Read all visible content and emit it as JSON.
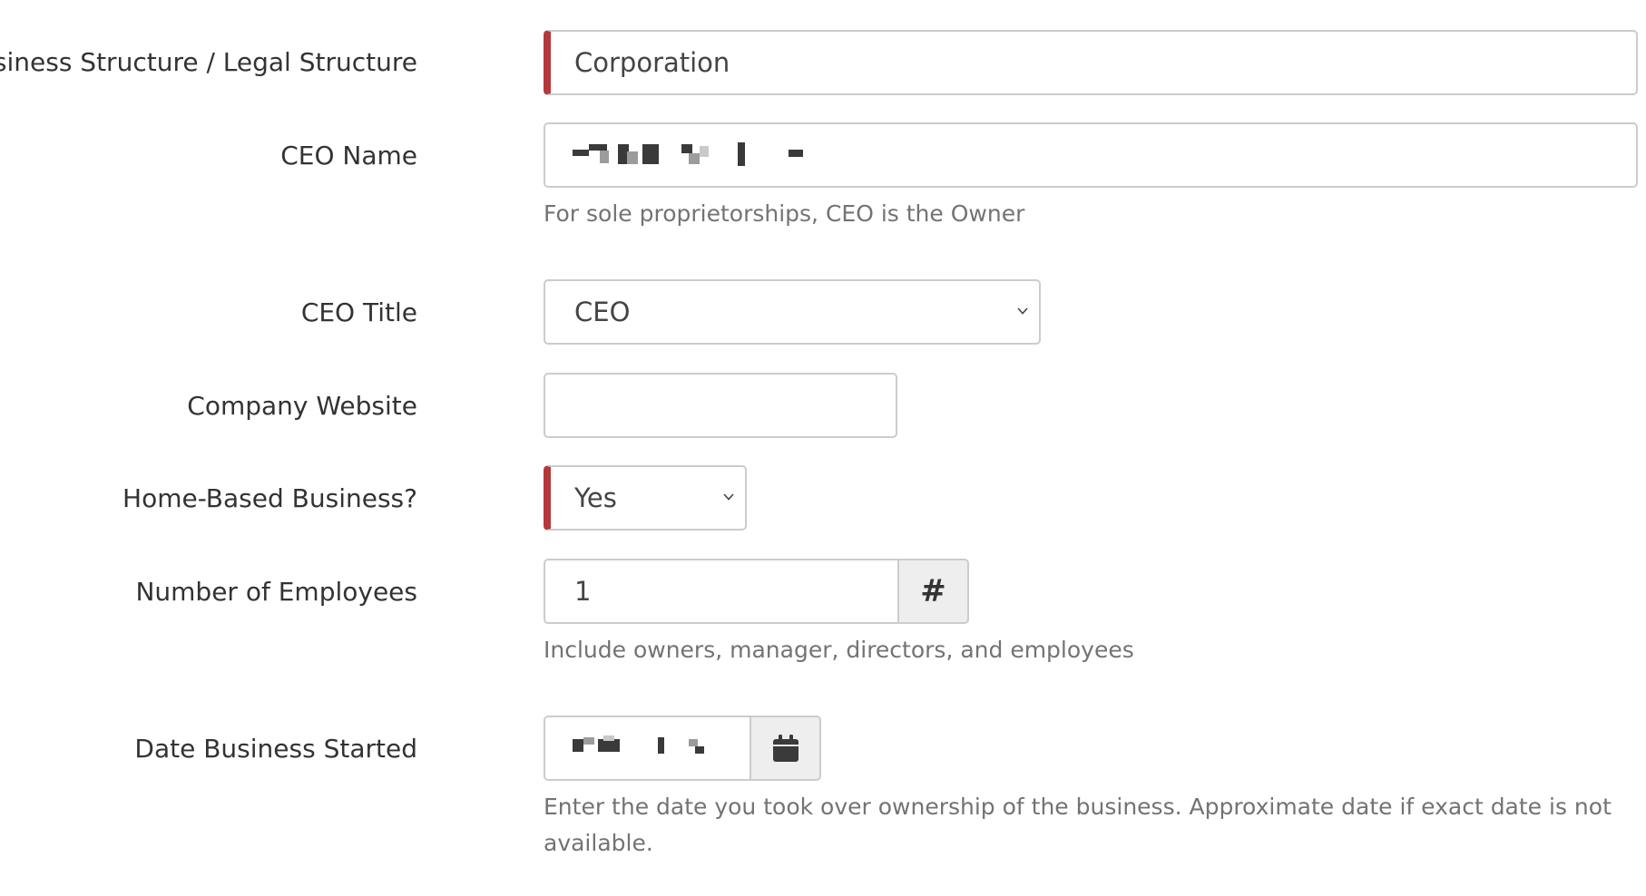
{
  "form": {
    "business_structure": {
      "label": "Business Structure / Legal Structure",
      "value": "Corporation"
    },
    "ceo_name": {
      "label": "CEO Name",
      "help": "For sole proprietorships, CEO is the Owner"
    },
    "ceo_title": {
      "label": "CEO Title",
      "value": "CEO",
      "icon": "chevron-down-icon"
    },
    "company_website": {
      "label": "Company Website",
      "value": ""
    },
    "home_based": {
      "label": "Home-Based Business?",
      "value": "Yes",
      "icon": "chevron-down-icon"
    },
    "employees": {
      "label": "Number of Employees",
      "value": "1",
      "addon": "#",
      "help": "Include owners, manager, directors, and employees"
    },
    "date_started": {
      "label": "Date Business Started",
      "icon": "calendar-icon",
      "help": "Enter the date you took over ownership of the business. Approximate date if exact date is not available."
    }
  },
  "colors": {
    "required_marker": "#b5393c",
    "border": "#cccccc",
    "help_text": "#737373",
    "addon_bg": "#eeeeee"
  }
}
